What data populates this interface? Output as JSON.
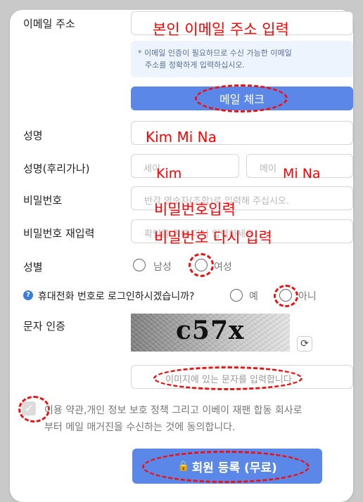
{
  "form": {
    "email": {
      "label": "이메일 주소",
      "value": ""
    },
    "email_notice": {
      "line1": "* 이메일 인증이 필요하므로 수신 가능한 이메일",
      "line2": "주소를 정확하게 입력하십시오."
    },
    "mail_check_button": "메일 체크",
    "name": {
      "label": "성명",
      "value": ""
    },
    "furigana": {
      "label": "성명(후리가나)",
      "last_placeholder": "세이",
      "first_placeholder": "메이"
    },
    "password": {
      "label": "비밀번호",
      "placeholder": "반각 영숫자(조합)로 입력해 주십시오."
    },
    "password_confirm": {
      "label": "비밀번호 재입력",
      "placeholder": "확인을 위해 다시 입력하세요."
    },
    "gender": {
      "label": "성별",
      "male": "남성",
      "female": "여성"
    },
    "phone_login": {
      "question": "휴대전화 번호로 로그인하시겠습니까?",
      "yes": "예",
      "no": "아니"
    },
    "captcha": {
      "label": "문자 인증",
      "image_text": "c57x",
      "input_placeholder": "이미지에 있는 문자를 입력합니다."
    },
    "agreement": {
      "line1": "이용 약관,개인 정보 보호 정책 그리고 이베이 재팬 합동 회사로",
      "line2": "부터 메일 매거진을 수신하는 것에 동의합니다."
    },
    "submit_button": "회원 등록 (무료)"
  },
  "annotations": {
    "email": "본인 이메일 주소 입력",
    "name": "Kim Mi Na",
    "last": "Kim",
    "first": "Mi Na",
    "password": "비밀번호입력",
    "password_confirm": "비밀번호 다시 입력"
  },
  "colors": {
    "accent": "#5b88e8",
    "annotation": "#ff0000",
    "info": "#3b7ddd"
  }
}
